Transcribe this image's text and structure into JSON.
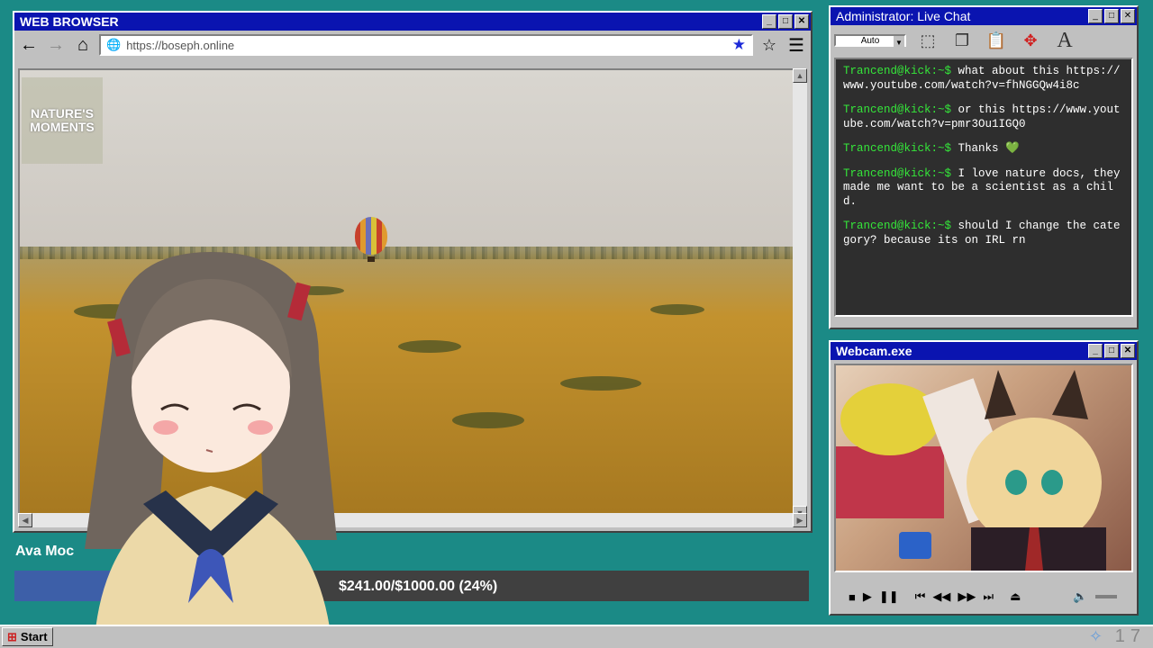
{
  "browser": {
    "title": "WEB BROWSER",
    "url": "https://boseph.online",
    "logo": "NATURE'S MOMENTS",
    "icons": {
      "back": "back-arrow-icon",
      "forward": "forward-arrow-icon",
      "home": "home-icon",
      "globe": "globe-icon",
      "bookmark_filled": "star-filled-icon",
      "bookmark": "star-outline-icon",
      "menu": "hamburger-menu-icon"
    }
  },
  "chat": {
    "title": "Administrator: Live Chat",
    "select_value": "Auto",
    "messages": [
      {
        "user": "Trancend@kick:~$",
        "text": " what about this https://www.youtube.com/watch?v=fhNGGQw4i8c"
      },
      {
        "user": "Trancend@kick:~$",
        "text": " or this https://www.youtube.com/watch?v=pmr3Ou1IGQ0"
      },
      {
        "user": "Trancend@kick:~$",
        "text": " Thanks 💚"
      },
      {
        "user": "Trancend@kick:~$",
        "text": " I love nature docs, they made me want to be a scientist as a child."
      },
      {
        "user": "Trancend@kick:~$",
        "text": " should I change the category? because its on IRL rn"
      }
    ]
  },
  "webcam": {
    "title": "Webcam.exe"
  },
  "donation": {
    "name": "Ava Moc",
    "progress_text": "$241.00/$1000.00 (24%)",
    "progress_fraction": 0.24
  },
  "taskbar": {
    "start_label": "Start",
    "clock": "17"
  },
  "colors": {
    "titlebar": "#0a14b0",
    "desktop": "#1b8a86",
    "chat_user": "#35e63a",
    "progress_fill": "#3d5fa8"
  }
}
